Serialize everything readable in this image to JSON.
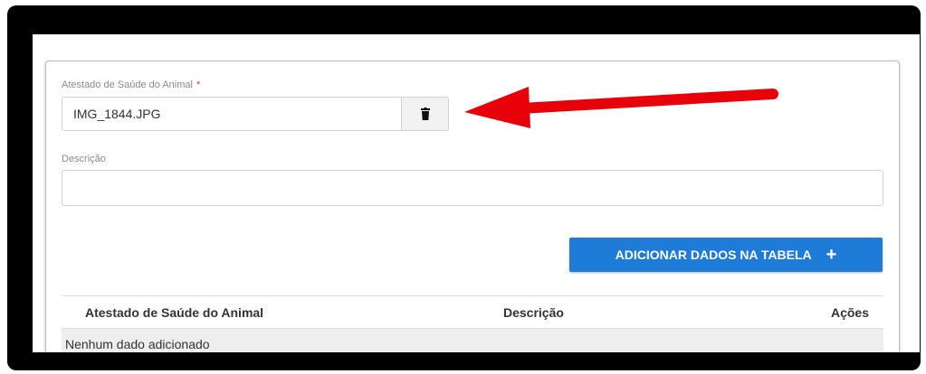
{
  "form": {
    "attachment_label": "Atestado de Saúde do Animal",
    "required_mark": "*",
    "attachment_filename": "IMG_1844.JPG",
    "delete_icon": "trash-icon",
    "description_label": "Descrição",
    "description_value": ""
  },
  "actions": {
    "add_label": "ADICIONAR DADOS NA TABELA",
    "add_icon": "+"
  },
  "table": {
    "columns": [
      "Atestado de Saúde do Animal",
      "Descrição",
      "Ações"
    ],
    "empty_message": "Nenhum dado adicionado"
  },
  "annotation": {
    "arrow_color": "#e8000b"
  },
  "colors": {
    "primary_button": "#1f7bd8",
    "required": "#e53935"
  }
}
